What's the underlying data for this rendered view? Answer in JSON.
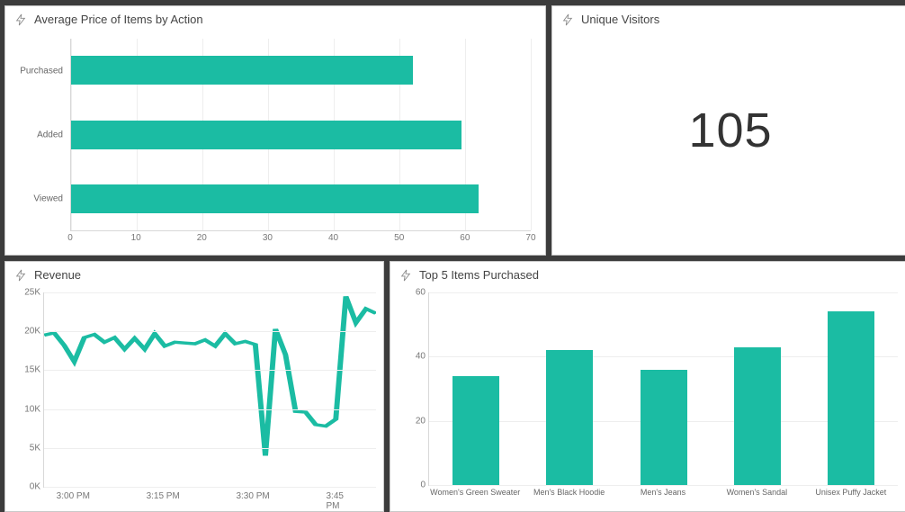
{
  "accent": "#1bbca3",
  "panel1": {
    "title": "Average Price of Items by Action",
    "x_ticks": [
      0,
      10,
      20,
      30,
      40,
      50,
      60,
      70
    ],
    "xmax": 70,
    "categories": [
      "Purchased",
      "Added",
      "Viewed"
    ],
    "values": [
      52,
      59.5,
      62
    ]
  },
  "panel2": {
    "title": "Unique Visitors",
    "value": "105"
  },
  "panel3": {
    "title": "Revenue",
    "y_ticks": [
      0,
      5000,
      10000,
      15000,
      20000,
      25000
    ],
    "y_tick_labels": [
      "0K",
      "5K",
      "10K",
      "15K",
      "20K",
      "25K"
    ],
    "ymax": 25000,
    "x_tick_labels": [
      "3:00 PM",
      "3:15 PM",
      "3:30 PM",
      "3:45 PM"
    ],
    "x_tick_positions": [
      0.09,
      0.36,
      0.63,
      0.9
    ],
    "series": [
      19500,
      19800,
      18200,
      16100,
      19200,
      19600,
      18600,
      19200,
      17700,
      19100,
      17700,
      19700,
      18100,
      18600,
      18500,
      18400,
      18900,
      18100,
      19700,
      18400,
      18700,
      18300,
      4000,
      20300,
      17000,
      9700,
      9600,
      8000,
      7800,
      8700,
      24500,
      21100,
      22900,
      22300
    ]
  },
  "panel4": {
    "title": "Top 5 Items Purchased",
    "y_ticks": [
      0,
      20,
      40,
      60
    ],
    "ymax": 60,
    "categories": [
      "Women's Green Sweater",
      "Men's Black Hoodie",
      "Men's Jeans",
      "Women's Sandal",
      "Unisex Puffy Jacket"
    ],
    "values": [
      34,
      42,
      36,
      43,
      54
    ]
  },
  "chart_data": [
    {
      "type": "bar",
      "orientation": "horizontal",
      "title": "Average Price of Items by Action",
      "categories": [
        "Purchased",
        "Added",
        "Viewed"
      ],
      "values": [
        52,
        59.5,
        62
      ],
      "xlabel": "",
      "ylabel": "",
      "xlim": [
        0,
        70
      ]
    },
    {
      "type": "scalar",
      "title": "Unique Visitors",
      "value": 105
    },
    {
      "type": "line",
      "title": "Revenue",
      "x_labels": [
        "3:00 PM",
        "3:15 PM",
        "3:30 PM",
        "3:45 PM"
      ],
      "y": [
        19500,
        19800,
        18200,
        16100,
        19200,
        19600,
        18600,
        19200,
        17700,
        19100,
        17700,
        19700,
        18100,
        18600,
        18500,
        18400,
        18900,
        18100,
        19700,
        18400,
        18700,
        18300,
        4000,
        20300,
        17000,
        9700,
        9600,
        8000,
        7800,
        8700,
        24500,
        21100,
        22900,
        22300
      ],
      "ylim": [
        0,
        25000
      ]
    },
    {
      "type": "bar",
      "title": "Top 5 Items Purchased",
      "categories": [
        "Women's Green Sweater",
        "Men's Black Hoodie",
        "Men's Jeans",
        "Women's Sandal",
        "Unisex Puffy Jacket"
      ],
      "values": [
        34,
        42,
        36,
        43,
        54
      ],
      "ylim": [
        0,
        60
      ]
    }
  ]
}
